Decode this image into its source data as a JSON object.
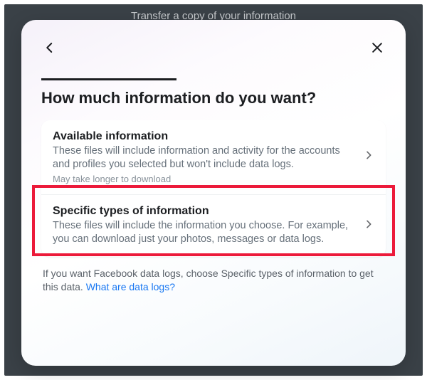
{
  "background": {
    "title": "Transfer a copy of your information"
  },
  "modal": {
    "title": "How much information do you want?",
    "options": [
      {
        "title": "Available information",
        "description": "These files will include information and activity for the accounts and profiles you selected but won't include data logs.",
        "note": "May take longer to download"
      },
      {
        "title": "Specific types of information",
        "description": "These files will include the information you choose. For example, you can download just your photos, messages or data logs."
      }
    ],
    "footer": {
      "text": "If you want Facebook data logs, choose Specific types of information to get this data. ",
      "link": "What are data logs?"
    }
  },
  "highlight": {
    "target": "option-specific-types"
  }
}
